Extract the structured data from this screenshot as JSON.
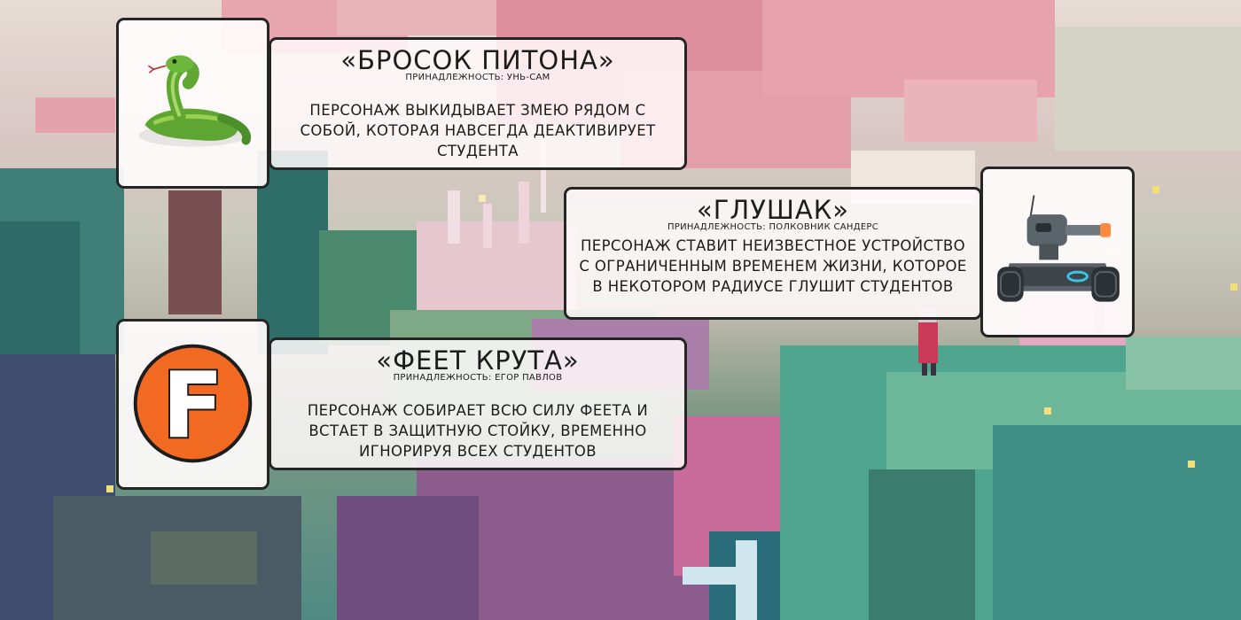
{
  "abilities": [
    {
      "icon": "snake-icon",
      "title": "«БРОСОК ПИТОНА»",
      "owner": "ПРИНАДЛЕЖНОСТЬ: УНЬ-САМ",
      "description": "ПЕРСОНАЖ ВЫКИДЫВАЕТ ЗМЕЮ РЯДОМ С СОБОЙ, КОТОРАЯ НАВСЕГДА ДЕАКТИВИРУЕТ СТУДЕНТА"
    },
    {
      "icon": "robot-tank-icon",
      "title": "«ГЛУШАК»",
      "owner": "ПРИНАДЛЕЖНОСТЬ: ПОЛКОВНИК САНДЕРС",
      "description": "ПЕРСОНАЖ СТАВИТ НЕИЗВЕСТНОЕ УСТРОЙСТВО С ОГРАНИЧЕННЫМ ВРЕМЕНЕМ ЖИЗНИ, КОТОРОЕ В НЕКОТОРОМ РАДИУСЕ ГЛУШИТ СТУДЕНТОВ"
    },
    {
      "icon": "letter-f-badge-icon",
      "badge_letter": "F",
      "title": "«ФЕЕТ КРУТА»",
      "owner": "ПРИНАДЛЕЖНОСТЬ: ЕГОР ПАВЛОВ",
      "description": "ПЕРСОНАЖ СОБИРАЕТ ВСЮ СИЛУ ФЕЕТА И ВСТАЕТ В ЗАЩИТНУЮ СТОЙКУ, ВРЕМЕННО ИГНОРИРУЯ ВСЕХ СТУДЕНТОВ"
    }
  ],
  "colors": {
    "card_border": "#252525",
    "card_fill": "#fffafa",
    "badge_orange": "#f26a21",
    "snake_green": "#6fb33a",
    "robot_blue": "#39c6e6"
  }
}
